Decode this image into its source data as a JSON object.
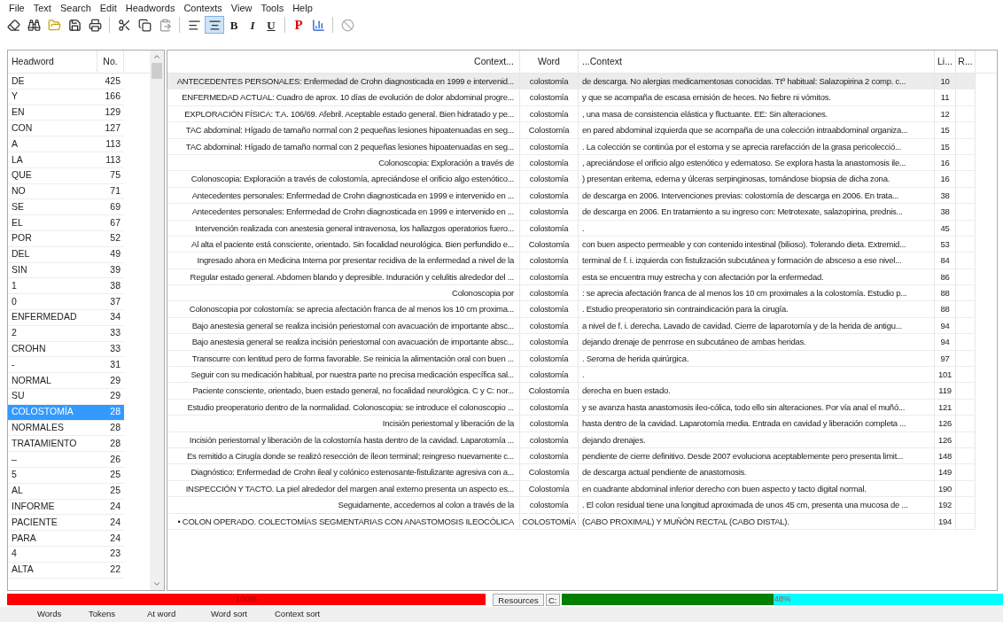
{
  "menu": [
    "File",
    "Text",
    "Search",
    "Edit",
    "Headwords",
    "Contexts",
    "View",
    "Tools",
    "Help"
  ],
  "toolbar": [
    {
      "kind": "eraser"
    },
    {
      "kind": "binoculars"
    },
    {
      "kind": "open"
    },
    {
      "kind": "save"
    },
    {
      "kind": "print"
    },
    {
      "kind": "separator"
    },
    {
      "kind": "cut"
    },
    {
      "kind": "copy"
    },
    {
      "kind": "paste"
    },
    {
      "kind": "separator"
    },
    {
      "kind": "align-left",
      "selected": false
    },
    {
      "kind": "align-center",
      "selected": true
    },
    {
      "kind": "glyph",
      "label": "B"
    },
    {
      "kind": "glyph",
      "label": "I"
    },
    {
      "kind": "glyph",
      "label": "U"
    },
    {
      "kind": "separator"
    },
    {
      "kind": "glyph",
      "label": "P"
    },
    {
      "kind": "chart"
    },
    {
      "kind": "separator"
    },
    {
      "kind": "disabled"
    }
  ],
  "headwords": {
    "columns": [
      "Headword",
      "No."
    ],
    "rows": [
      {
        "word": "DE",
        "count": "425",
        "selected": false
      },
      {
        "word": "Y",
        "count": "166",
        "selected": false
      },
      {
        "word": "EN",
        "count": "129",
        "selected": false
      },
      {
        "word": "CON",
        "count": "127",
        "selected": false
      },
      {
        "word": "A",
        "count": "113",
        "selected": false
      },
      {
        "word": "LA",
        "count": "113",
        "selected": false
      },
      {
        "word": "QUE",
        "count": "75",
        "selected": false
      },
      {
        "word": "NO",
        "count": "71",
        "selected": false
      },
      {
        "word": "SE",
        "count": "69",
        "selected": false
      },
      {
        "word": "EL",
        "count": "67",
        "selected": false
      },
      {
        "word": "POR",
        "count": "52",
        "selected": false
      },
      {
        "word": "DEL",
        "count": "49",
        "selected": false
      },
      {
        "word": "SIN",
        "count": "39",
        "selected": false
      },
      {
        "word": "1",
        "count": "38",
        "selected": false
      },
      {
        "word": "0",
        "count": "37",
        "selected": false
      },
      {
        "word": "ENFERMEDAD",
        "count": "34",
        "selected": false
      },
      {
        "word": "2",
        "count": "33",
        "selected": false
      },
      {
        "word": "CROHN",
        "count": "33",
        "selected": false
      },
      {
        "word": "-",
        "count": "31",
        "selected": false
      },
      {
        "word": "NORMAL",
        "count": "29",
        "selected": false
      },
      {
        "word": "SU",
        "count": "29",
        "selected": false
      },
      {
        "word": "COLOSTOMÍA",
        "count": "28",
        "selected": true
      },
      {
        "word": "NORMALES",
        "count": "28",
        "selected": false
      },
      {
        "word": "TRATAMIENTO",
        "count": "28",
        "selected": false
      },
      {
        "word": "–",
        "count": "26",
        "selected": false
      },
      {
        "word": "5",
        "count": "25",
        "selected": false
      },
      {
        "word": "AL",
        "count": "25",
        "selected": false
      },
      {
        "word": "INFORME",
        "count": "24",
        "selected": false
      },
      {
        "word": "PACIENTE",
        "count": "24",
        "selected": false
      },
      {
        "word": "PARA",
        "count": "24",
        "selected": false
      },
      {
        "word": "4",
        "count": "23",
        "selected": false
      },
      {
        "word": "ALTA",
        "count": "22",
        "selected": false
      }
    ]
  },
  "concordance": {
    "columns": [
      "Context...",
      "Word",
      "...Context",
      "Li...",
      "R..."
    ],
    "rows": [
      {
        "left": "ANTECEDENTES PERSONALES: Enfermedad de Crohn diagnosticada en 1999 e intervenid...",
        "word": "colostomía",
        "right": "de descarga. No alergias medicamentosas conocidas. Ttº habitual: Salazopirina 2 comp. c...",
        "line": "10",
        "selected": true
      },
      {
        "left": "ENFERMEDAD ACTUAL: Cuadro de aprox. 10 días de evolución de dolor abdominal progre...",
        "word": "colostomía",
        "right": "y que se acompaña de escasa emisión de heces. No fiebre ni vómitos.",
        "line": "11",
        "selected": false
      },
      {
        "left": "EXPLORACIÓN FÍSICA: T.A. 106/69. Afebril. Aceptable estado general. Bien hidratado y pe...",
        "word": "colostomía",
        "right": ", una masa de consistencia elástica y fluctuante. EE: Sin alteraciones.",
        "line": "12",
        "selected": false
      },
      {
        "left": "TAC abdominal: Hígado de tamaño normal con 2 pequeñas lesiones hipoatenuadas en seg...",
        "word": "Colostomía",
        "right": "en pared abdominal izquierda que se acompaña de una colección intraabdominal organiza...",
        "line": "15",
        "selected": false
      },
      {
        "left": "TAC abdominal: Hígado de tamaño normal con 2 pequeñas lesiones hipoatenuadas en seg...",
        "word": "colostomía",
        "right": ". La colección se continúa por el estoma y se aprecia rarefacción de la grasa pericolecció...",
        "line": "15",
        "selected": false
      },
      {
        "left": "Colonoscopia: Exploración a través de",
        "word": "colostomía",
        "right": ", apreciándose el orificio algo estenótico y edematoso. Se explora hasta la anastomosis ile...",
        "line": "16",
        "selected": false
      },
      {
        "left": "Colonoscopia: Exploración a través de colostomía, apreciándose el orificio algo estenótico...",
        "word": "colostomía",
        "right": ") presentan eritema, edema y úlceras serpinginosas, tomándose biopsia de dicha zona.",
        "line": "16",
        "selected": false
      },
      {
        "left": "Antecedentes personales: Enfermedad de Crohn diagnosticada en 1999 e intervenido en ...",
        "word": "colostomía",
        "right": "de descarga en 2006. Intervenciones previas: colostomía de descarga en 2006. En trata...",
        "line": "38",
        "selected": false
      },
      {
        "left": "Antecedentes personales: Enfermedad de Crohn diagnosticada en 1999 e intervenido en ...",
        "word": "colostomía",
        "right": "de descarga en 2006. En tratamiento a su ingreso con: Metrotexate, salazopirina, prednis...",
        "line": "38",
        "selected": false
      },
      {
        "left": "Intervención realizada con anestesia general intravenosa, los hallazgos operatorios fuero...",
        "word": "colostomía",
        "right": ".",
        "line": "45",
        "selected": false
      },
      {
        "left": "Al alta el paciente está consciente, orientado. Sin focalidad neurológica. Bien perfundido e...",
        "word": "Colostomía",
        "right": "con buen aspecto permeable y con contenido intestinal (bilioso). Tolerando dieta. Extremid...",
        "line": "53",
        "selected": false
      },
      {
        "left": "Ingresado ahora en Medicina Interna por presentar recidiva de la enfermedad a nivel de la",
        "word": "colostomía",
        "right": "terminal de f. i. izquierda con fistulización subcutánea y formación de absceso a ese nivel...",
        "line": "84",
        "selected": false
      },
      {
        "left": "Regular estado general. Abdomen blando y depresible. Induración y celulitis alrededor del ...",
        "word": "colostomía",
        "right": "esta se encuentra muy estrecha y con afectación por la enfermedad.",
        "line": "86",
        "selected": false
      },
      {
        "left": "Colonoscopia por",
        "word": "colostomía",
        "right": ": se aprecia afectación franca de al menos los 10 cm proximales a la colostomía. Estudio p...",
        "line": "88",
        "selected": false
      },
      {
        "left": "Colonoscopia por colostomía: se aprecia afectación franca de al menos los 10 cm proxima...",
        "word": "colostomía",
        "right": ". Estudio preoperatorio sin contraindicación para la cirugía.",
        "line": "88",
        "selected": false
      },
      {
        "left": "Bajo anestesia general se realiza incisión periestomal con avacuación de importante absc...",
        "word": "colostomía",
        "right": "a nivel de f. i. derecha. Lavado de cavidad. Cierre de laparotomía y de la herida de antigu...",
        "line": "94",
        "selected": false
      },
      {
        "left": "Bajo anestesia general se realiza incisión periestomal con avacuación de importante absc...",
        "word": "colostomía",
        "right": "dejando drenaje de penrrose en subcutáneo de ambas heridas.",
        "line": "94",
        "selected": false
      },
      {
        "left": "Transcurre con lentitud pero de forma favorable. Se reinicia la alimentación oral con buen ...",
        "word": "colostomía",
        "right": ". Seroma de herida quirúrgica.",
        "line": "97",
        "selected": false
      },
      {
        "left": "Seguir con su medicación habitual, por nuestra parte no precisa medicación específica sal...",
        "word": "colostomía",
        "right": ".",
        "line": "101",
        "selected": false
      },
      {
        "left": "Paciente consciente, orientado, buen estado general, no focalidad neurológica. C y C: nor...",
        "word": "Colostomía",
        "right": "derecha en buen estado.",
        "line": "119",
        "selected": false
      },
      {
        "left": "Estudio preoperatorio dentro de la normalidad. Colonoscopia: se introduce el colonoscopio ...",
        "word": "colostomía",
        "right": "y se avanza hasta anastomosis ileo-cólica, todo ello sin alteraciones. Por vía anal el muñó...",
        "line": "121",
        "selected": false
      },
      {
        "left": "Incisión periestomal y liberación de la",
        "word": "colostomía",
        "right": "hasta dentro de la cavidad. Laparotomía media. Entrada en cavidad y liberación completa ...",
        "line": "126",
        "selected": false
      },
      {
        "left": "Incisión periestomal y liberación de la colostomía hasta dentro de la cavidad. Laparotomía ...",
        "word": "colostomía",
        "right": "dejando drenajes.",
        "line": "126",
        "selected": false
      },
      {
        "left": "Es remitido a Cirugía donde se realizó resección de íleon terminal; reingreso nuevamente c...",
        "word": "colostomía",
        "right": "pendiente de cierre definitivo. Desde 2007 evoluciona aceptablemente pero presenta limit...",
        "line": "148",
        "selected": false
      },
      {
        "left": "Diagnóstico: Enfermedad de Crohn ileal y colónico estenosante-fistulizante agresiva con a...",
        "word": "Colostomía",
        "right": "de descarga actual pendiente de anastomosis.",
        "line": "149",
        "selected": false
      },
      {
        "left": "INSPECCIÓN Y TACTO. La piel alrededor del margen anal externo presenta un aspecto es...",
        "word": "Colostomía",
        "right": "en cuadrante abdominal inferior derecho con buen aspecto y tacto digital normal.",
        "line": "190",
        "selected": false
      },
      {
        "left": "Seguidamente, accedemos al colon a través de la",
        "word": "colostomía",
        "right": ". El colon residual tiene una longitud aproximada de unos 45 cm, presenta una mucosa de ...",
        "line": "192",
        "selected": false
      },
      {
        "left": "• COLON OPERADO. COLECTOMÍAS SEGMENTARIAS CON ANASTOMOSIS ILEOCÓLICA",
        "word": "COLOSTOMÍA",
        "right": "(CABO PROXIMAL) Y MUÑÓN RECTAL (CABO DISTAL).",
        "line": "194",
        "selected": false
      }
    ]
  },
  "progress": [
    {
      "label": "100%",
      "level": 1
    },
    {
      "label": "48%",
      "level": 0.48
    }
  ],
  "resources": {
    "label": "Resources",
    "drive": "C:"
  },
  "status_bar": [
    "Words",
    "Tokens",
    "At word",
    "Word sort",
    "Context sort"
  ]
}
